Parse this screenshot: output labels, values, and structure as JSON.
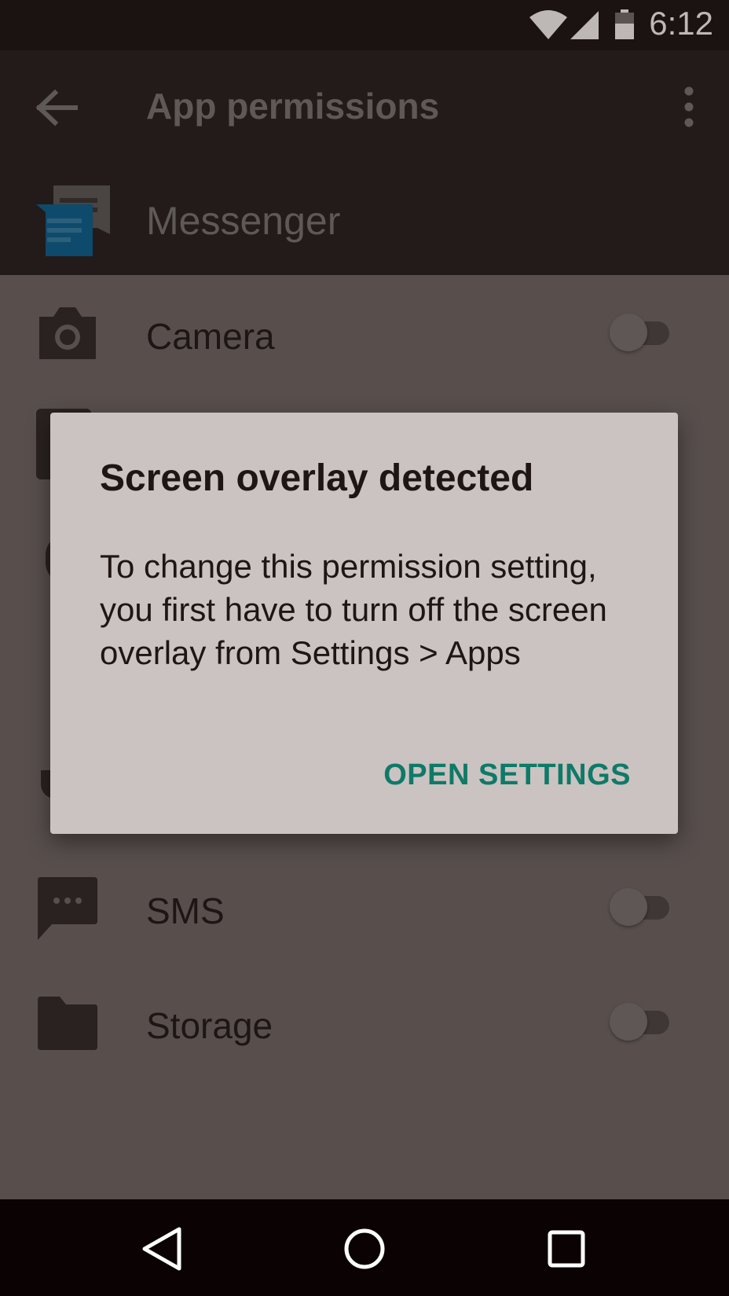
{
  "status_bar": {
    "time": "6:12",
    "icons": [
      "wifi-icon",
      "signal-icon",
      "battery-icon"
    ]
  },
  "app_bar": {
    "title": "App permissions",
    "back_icon": "arrow-back-icon",
    "overflow_icon": "more-vert-icon"
  },
  "app_header": {
    "app_name": "Messenger",
    "icon": "messenger-icon"
  },
  "permissions": [
    {
      "label": "Camera",
      "icon": "camera-icon",
      "enabled": false
    },
    {
      "label": "SMS",
      "icon": "sms-icon",
      "enabled": false
    },
    {
      "label": "Storage",
      "icon": "folder-icon",
      "enabled": false
    }
  ],
  "dialog": {
    "title": "Screen overlay detected",
    "message": "To change this permission setting, you first have to turn off the screen overlay from Settings > Apps",
    "button": "OPEN SETTINGS"
  },
  "nav_bar": {
    "icons": [
      "back-nav-icon",
      "home-nav-icon",
      "recents-nav-icon"
    ]
  },
  "colors": {
    "accent": "#0e7a68",
    "dialog_bg": "#cbc3c1",
    "scrim_bg": "#584f4d",
    "app_bar_bg": "#221b1a",
    "messenger_blue": "#0e4a6b"
  }
}
